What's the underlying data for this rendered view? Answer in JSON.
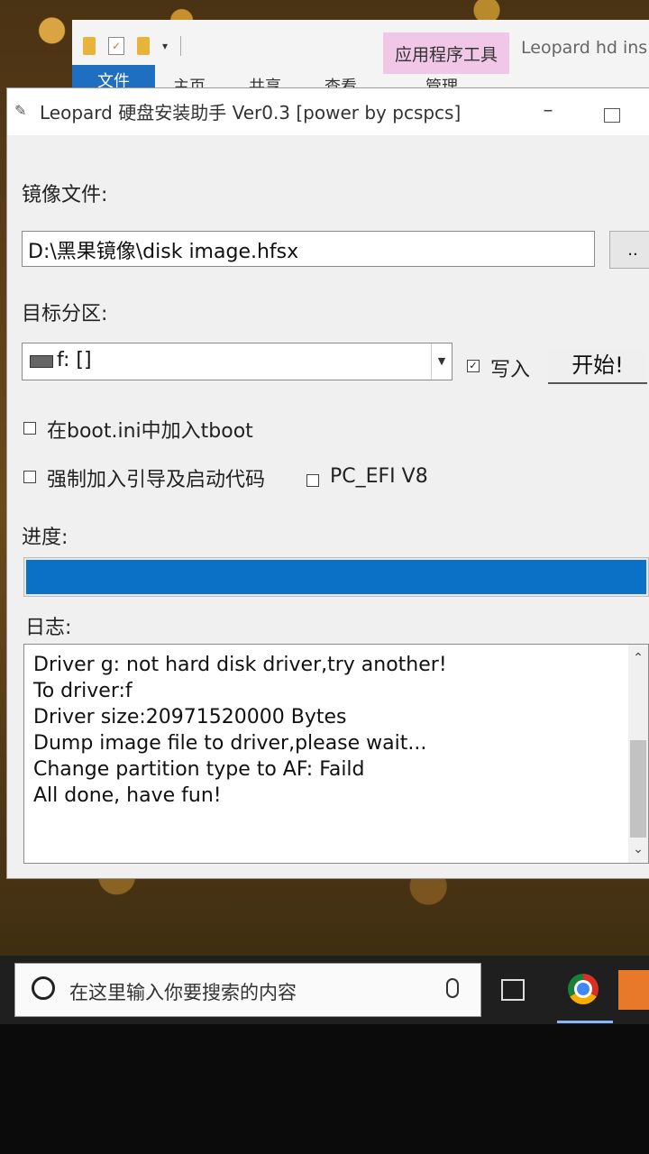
{
  "explorer": {
    "app_tools_tab": "应用程序工具",
    "title": "Leopard hd ins",
    "tabs": [
      "文件",
      "主页",
      "共享",
      "查看",
      "管理"
    ]
  },
  "dialog": {
    "title": "Leopard 硬盘安装助手 Ver0.3 [power by pcspcs]",
    "image_file_label": "镜像文件:",
    "image_file_value": "D:\\黑果镜像\\disk image.hfsx",
    "browse_label": "..",
    "target_partition_label": "目标分区:",
    "target_partition_value": "f: []",
    "write_label": "写入",
    "write_checked": true,
    "start_label": "开始!",
    "boot_ini_label": "在boot.ini中加入tboot",
    "boot_ini_checked": false,
    "force_boot_label": "强制加入引导及启动代码",
    "force_boot_checked": false,
    "pc_efi_label": "PC_EFI V8",
    "pc_efi_checked": false,
    "progress_label": "进度:",
    "progress_value": 1.0,
    "log_label": "日志:",
    "log_lines": [
      "Driver g: not hard disk driver,try another!",
      "To driver:f",
      "Driver size:20971520000 Bytes",
      "Dump image file to driver,please wait...",
      "Change partition type to AF: Faild",
      "All done, have fun!"
    ]
  },
  "taskbar": {
    "search_placeholder": "在这里输入你要搜索的内容"
  },
  "colors": {
    "progress_fill": "#0a71c7",
    "file_tab": "#1e6fc1",
    "app_tools_tab": "#f0c7e6"
  }
}
